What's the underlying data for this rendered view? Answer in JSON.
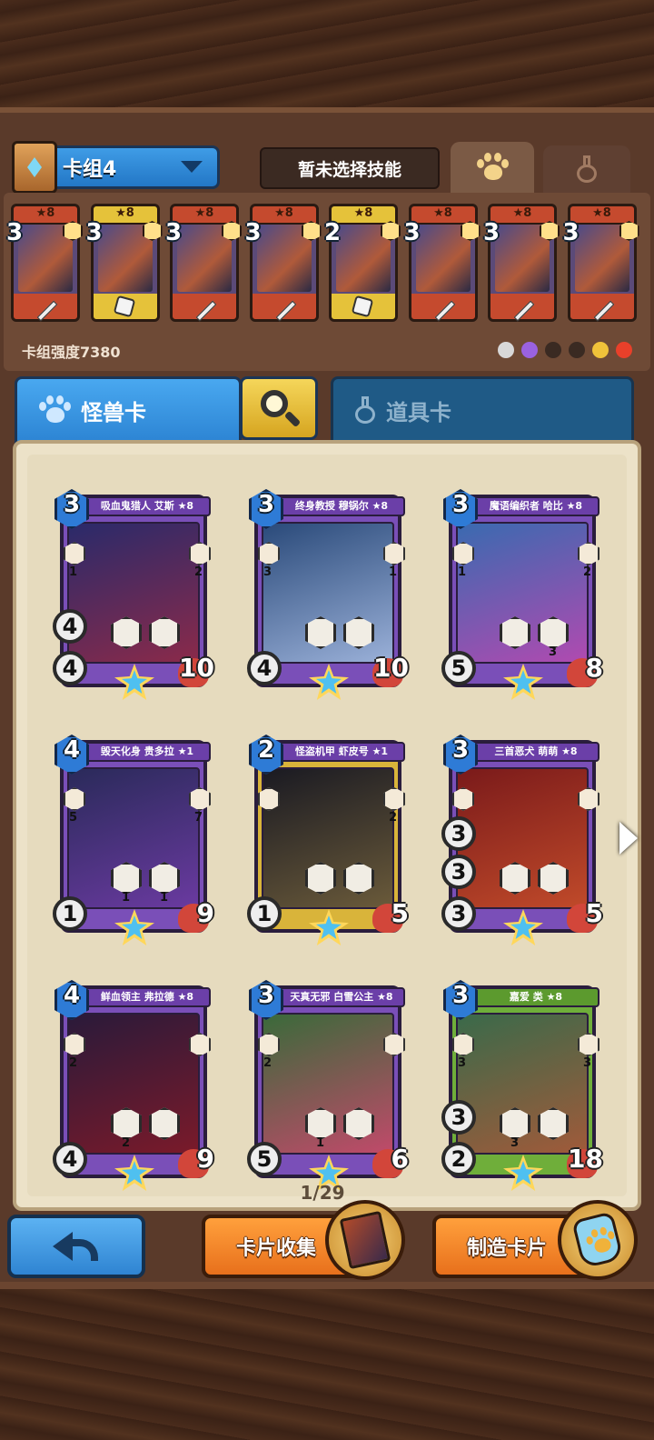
{
  "deck_header": {
    "deck_name": "卡组4",
    "skill_status": "暂未选择技能"
  },
  "deck": {
    "cards": [
      {
        "cost": "3",
        "star_level": "★8",
        "frame": "red",
        "bottom_icon": "sword"
      },
      {
        "cost": "3",
        "star_level": "★8",
        "frame": "gold",
        "bottom_icon": "dice"
      },
      {
        "cost": "3",
        "star_level": "★8",
        "frame": "red",
        "bottom_icon": "sword"
      },
      {
        "cost": "3",
        "star_level": "★8",
        "frame": "red",
        "bottom_icon": "sword"
      },
      {
        "cost": "2",
        "star_level": "★8",
        "frame": "gold",
        "bottom_icon": "dice"
      },
      {
        "cost": "3",
        "star_level": "★8",
        "frame": "red",
        "bottom_icon": "sword"
      },
      {
        "cost": "3",
        "star_level": "★8",
        "frame": "red",
        "bottom_icon": "sword"
      },
      {
        "cost": "3",
        "star_level": "★8",
        "frame": "red",
        "bottom_icon": "sword"
      }
    ],
    "power_label": "卡组强度7380",
    "synergy_colors": [
      "#d8d8d8",
      "#9a62e0",
      "#3a2a22",
      "#3a2a22",
      "#f0c23a",
      "#e8402a"
    ]
  },
  "category_tabs": {
    "monster": "怪兽卡",
    "item": "道具卡"
  },
  "collection": {
    "cards": [
      {
        "name": "吸血鬼猎人 艾斯 ★8",
        "cost": "3",
        "frame": "purple",
        "stat_top": "4",
        "stat_bottom": "4",
        "hp": "10",
        "badge_left": "1",
        "badge_right": "2",
        "skill_nums": [
          "",
          ""
        ],
        "art": [
          "#2a2a6a",
          "#8a2a4a"
        ]
      },
      {
        "name": "终身教授 穆锅尔 ★8",
        "cost": "3",
        "frame": "purple",
        "stat_top": "",
        "stat_bottom": "4",
        "hp": "10",
        "badge_left": "3",
        "badge_right": "1",
        "skill_nums": [
          "",
          ""
        ],
        "art": [
          "#2a4a7a",
          "#9ab0d8"
        ]
      },
      {
        "name": "魔语编织者 哈比 ★8",
        "cost": "3",
        "frame": "purple",
        "stat_top": "",
        "stat_bottom": "5",
        "hp": "8",
        "badge_left": "1",
        "badge_right": "2",
        "skill_nums": [
          "",
          "3"
        ],
        "art": [
          "#3a6ab0",
          "#b04ab0"
        ]
      },
      {
        "name": "毁天化身 贵多拉 ★1",
        "cost": "4",
        "frame": "purple",
        "stat_top": "",
        "stat_bottom": "1",
        "hp": "9",
        "badge_left": "5",
        "badge_right": "7",
        "skill_nums": [
          "1",
          "1"
        ],
        "art": [
          "#2a2a5a",
          "#6a3aa0"
        ]
      },
      {
        "name": "怪盗机甲 虾皮号 ★1",
        "cost": "2",
        "frame": "gold",
        "stat_top": "",
        "stat_bottom": "1",
        "hp": "5",
        "badge_left": "",
        "badge_right": "2",
        "skill_nums": [
          "",
          ""
        ],
        "art": [
          "#1a1a22",
          "#6a5a3a"
        ]
      },
      {
        "name": "三首恶犬 萌萌 ★8",
        "cost": "3",
        "frame": "purple",
        "stat_top": "3",
        "stat_bottom": "3",
        "hp": "5",
        "badge_left": "",
        "badge_right": "",
        "skill_nums": [
          "",
          ""
        ],
        "stat_mid": "3",
        "art": [
          "#7a1a1a",
          "#c04a2a"
        ]
      },
      {
        "name": "鲜血领主 弗拉德 ★8",
        "cost": "4",
        "frame": "purple",
        "stat_top": "",
        "stat_bottom": "4",
        "hp": "9",
        "badge_left": "2",
        "badge_right": "",
        "skill_nums": [
          "2",
          ""
        ],
        "art": [
          "#2a1a3a",
          "#7a1a2a"
        ]
      },
      {
        "name": "天真无邪 白雪公主 ★8",
        "cost": "3",
        "frame": "purple",
        "stat_top": "",
        "stat_bottom": "5",
        "hp": "6",
        "badge_left": "2",
        "badge_right": "",
        "skill_nums": [
          "1",
          ""
        ],
        "art": [
          "#3a6a3a",
          "#c04a6a"
        ]
      },
      {
        "name": "嘉爱 类 ★8",
        "cost": "3",
        "frame": "green",
        "stat_top": "3",
        "stat_bottom": "2",
        "hp": "18",
        "badge_left": "3",
        "badge_right": "3",
        "skill_nums": [
          "3",
          ""
        ],
        "art": [
          "#3a6a4a",
          "#a05a3a"
        ]
      }
    ],
    "page_indicator": "1/29"
  },
  "bottom_bar": {
    "collection_button": "卡片收集",
    "craft_button": "制造卡片"
  }
}
